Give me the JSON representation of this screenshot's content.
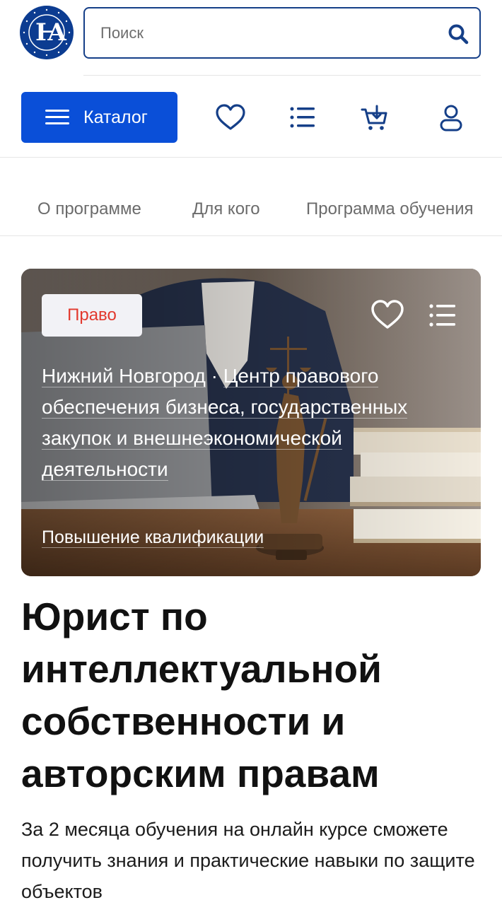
{
  "header": {
    "search_placeholder": "Поиск"
  },
  "toolbar": {
    "catalog_label": "Каталог"
  },
  "tabs": [
    {
      "label": "О программе"
    },
    {
      "label": "Для кого"
    },
    {
      "label": "Программа обучения"
    }
  ],
  "hero": {
    "badge": "Право",
    "badge_color": "#e2392e",
    "location": "Нижний Новгород",
    "separator": "·",
    "department": "Центр правового обеспечения бизнеса, государственных закупок и внешнеэкономической деятельности",
    "program_type": "Повышение квалификации"
  },
  "course": {
    "title": "Юрист по интеллектуальной собственности и авторским правам",
    "description": "За 2 месяца обучения на онлайн курсе сможете получить знания и практические навыки по защите объектов"
  },
  "colors": {
    "brand_blue": "#0a4fd8",
    "logo_blue": "#0c3c91",
    "icon_blue": "#153f88"
  },
  "icons": {
    "search": "search-icon",
    "catalog": "menu-burger-icon",
    "favorites": "heart-icon",
    "compare": "list-icon",
    "cart": "cart-icon",
    "profile": "user-icon"
  }
}
